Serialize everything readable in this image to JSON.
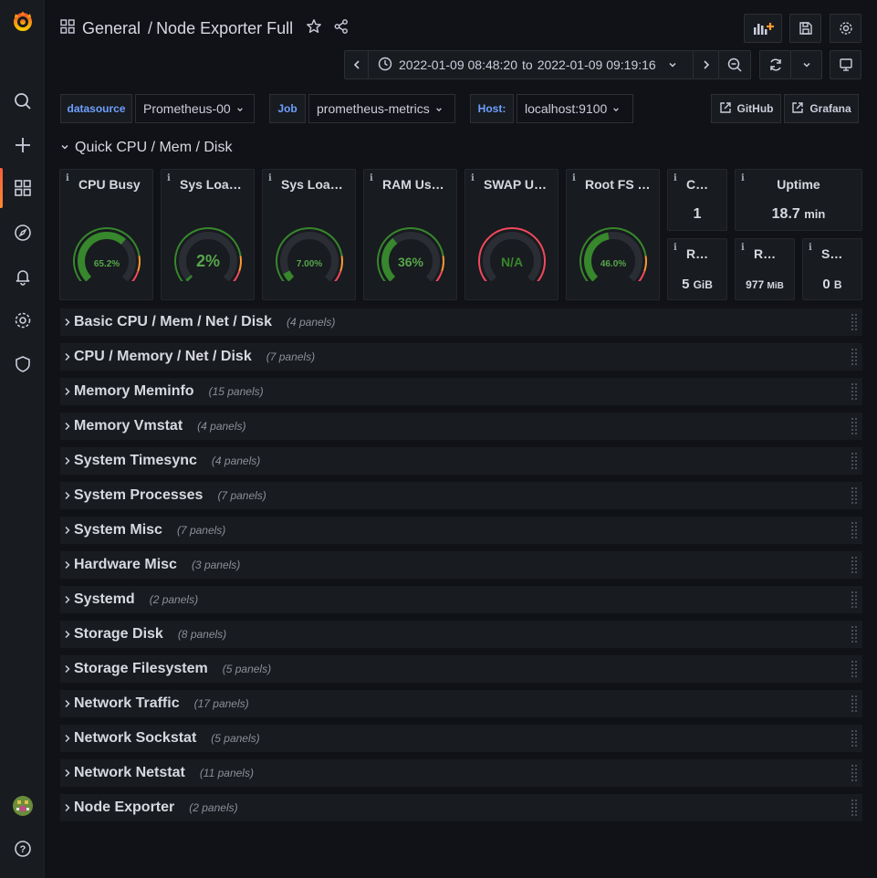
{
  "header": {
    "folder": "General",
    "separator": "/",
    "dashboard": "Node Exporter Full"
  },
  "time": {
    "from": "2022-01-09 08:48:20",
    "to_label": "to",
    "to": "2022-01-09 09:19:16"
  },
  "variables": [
    {
      "label": "datasource",
      "value": "Prometheus-00"
    },
    {
      "label": "Job",
      "value": "prometheus-metrics"
    },
    {
      "label": "Host:",
      "value": "localhost:9100"
    }
  ],
  "links": [
    {
      "label": "GitHub"
    },
    {
      "label": "Grafana"
    }
  ],
  "open_row": {
    "title": "Quick CPU / Mem / Disk"
  },
  "gauges": [
    {
      "title": "CPU Busy",
      "value": "65.2%",
      "fraction": 0.652,
      "color": "#37872d"
    },
    {
      "title": "Sys Loa…",
      "value": "2%",
      "fraction": 0.02,
      "color": "#37872d"
    },
    {
      "title": "Sys Loa…",
      "value": "7.00%",
      "fraction": 0.07,
      "color": "#37872d"
    },
    {
      "title": "RAM Us…",
      "value": "36%",
      "fraction": 0.36,
      "color": "#37872d"
    },
    {
      "title": "SWAP U…",
      "value": "N/A",
      "fraction": 0,
      "color": "#37872d"
    },
    {
      "title": "Root FS …",
      "value": "46.0%",
      "fraction": 0.46,
      "color": "#37872d"
    }
  ],
  "stats": {
    "cores": {
      "title": "C…",
      "value": "1"
    },
    "uptime": {
      "title": "Uptime",
      "value": "18.7",
      "unit": "min"
    },
    "ram_total": {
      "title": "R…",
      "value": "5",
      "unit": "GiB"
    },
    "rootfs_total": {
      "title": "R…",
      "value": "977",
      "unit": "MiB"
    },
    "swap_total": {
      "title": "S…",
      "value": "0",
      "unit": "B"
    }
  },
  "rows": [
    {
      "title": "Basic CPU / Mem / Net / Disk",
      "count": "(4 panels)"
    },
    {
      "title": "CPU / Memory / Net / Disk",
      "count": "(7 panels)"
    },
    {
      "title": "Memory Meminfo",
      "count": "(15 panels)"
    },
    {
      "title": "Memory Vmstat",
      "count": "(4 panels)"
    },
    {
      "title": "System Timesync",
      "count": "(4 panels)"
    },
    {
      "title": "System Processes",
      "count": "(7 panels)"
    },
    {
      "title": "System Misc",
      "count": "(7 panels)"
    },
    {
      "title": "Hardware Misc",
      "count": "(3 panels)"
    },
    {
      "title": "Systemd",
      "count": "(2 panels)"
    },
    {
      "title": "Storage Disk",
      "count": "(8 panels)"
    },
    {
      "title": "Storage Filesystem",
      "count": "(5 panels)"
    },
    {
      "title": "Network Traffic",
      "count": "(17 panels)"
    },
    {
      "title": "Network Sockstat",
      "count": "(5 panels)"
    },
    {
      "title": "Network Netstat",
      "count": "(11 panels)"
    },
    {
      "title": "Node Exporter",
      "count": "(2 panels)"
    }
  ],
  "colors": {
    "background": "#111217",
    "panel": "#181b1f",
    "gauge_green": "#37872d",
    "gauge_orange": "#ff9830",
    "gauge_red": "#f2495c",
    "accent_blue": "#6e9fff"
  }
}
